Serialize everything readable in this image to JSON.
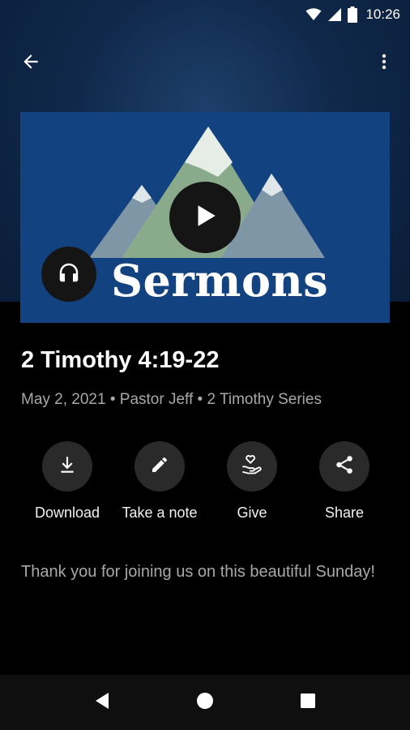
{
  "status_bar": {
    "time": "10:26",
    "icons": [
      "wifi-icon",
      "signal-icon",
      "battery-icon"
    ]
  },
  "app_bar": {
    "back_icon": "arrow-back-icon",
    "more_icon": "more-vert-icon"
  },
  "artwork": {
    "title": "Sermons",
    "background_color": "#134280",
    "play_icon": "play-icon",
    "audio_icon": "headphones-icon"
  },
  "sermon": {
    "title": "2 Timothy 4:19-22",
    "meta": "May 2, 2021 • Pastor Jeff • 2 Timothy Series",
    "description": "Thank you for joining us on this beautiful Sunday!"
  },
  "actions": [
    {
      "label": "Download",
      "icon": "download-icon"
    },
    {
      "label": "Take a note",
      "icon": "pencil-icon"
    },
    {
      "label": "Give",
      "icon": "give-heart-hand-icon"
    },
    {
      "label": "Share",
      "icon": "share-icon"
    }
  ],
  "nav_bar": {
    "icons": [
      "nav-back-icon",
      "nav-home-icon",
      "nav-recents-icon"
    ]
  },
  "colors": {
    "hero_background": "#10284a",
    "action_circle": "#2a2a2a",
    "secondary_text": "#a8a8a8"
  }
}
